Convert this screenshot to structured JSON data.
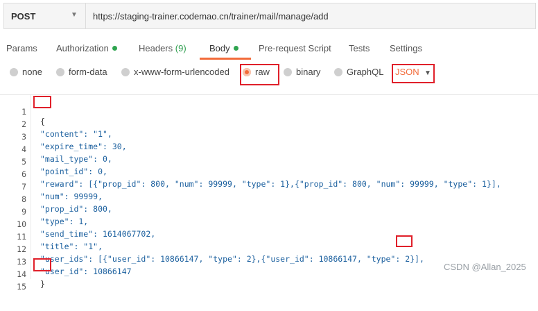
{
  "request": {
    "method": "POST",
    "url": "https://staging-trainer.codemao.cn/trainer/mail/manage/add"
  },
  "tabs": [
    {
      "label": "Params"
    },
    {
      "label": "Authorization"
    },
    {
      "label": "Headers",
      "count": "(9)"
    },
    {
      "label": "Body"
    },
    {
      "label": "Pre-request Script"
    },
    {
      "label": "Tests"
    },
    {
      "label": "Settings"
    }
  ],
  "body_types": [
    "none",
    "form-data",
    "x-www-form-urlencoded",
    "raw",
    "binary",
    "GraphQL"
  ],
  "selected_body_type": "raw",
  "format": "JSON",
  "code_lines": [
    {
      "n": "1",
      "t": "{"
    },
    {
      "n": "2",
      "t": "\"content\": \"1\","
    },
    {
      "n": "3",
      "t": "\"expire_time\": 30,"
    },
    {
      "n": "4",
      "t": "\"mail_type\": 0,"
    },
    {
      "n": "5",
      "t": "\"point_id\": 0,"
    },
    {
      "n": "6",
      "t": "\"reward\": [{\"prop_id\": 800, \"num\": 99999, \"type\": 1},{\"prop_id\": 800, \"num\": 99999, \"type\": 1}],"
    },
    {
      "n": "7",
      "t": "\"num\": 99999,"
    },
    {
      "n": "8",
      "t": "\"prop_id\": 800,"
    },
    {
      "n": "9",
      "t": "\"type\": 1,"
    },
    {
      "n": "10",
      "t": "\"send_time\": 1614067702,"
    },
    {
      "n": "11",
      "t": "\"title\": \"1\","
    },
    {
      "n": "12",
      "t": "\"user_ids\": [{\"user_id\": 10866147, \"type\": 2},{\"user_id\": 10866147, \"type\": 2}],"
    },
    {
      "n": "13",
      "t": "\"user_id\": 10866147"
    },
    {
      "n": "14",
      "t": "}"
    },
    {
      "n": "15",
      "t": ""
    }
  ],
  "watermark": "CSDN @Allan_2025",
  "colors": {
    "accent": "#f26b3a",
    "status_green": "#2ea44f",
    "highlight_box": "#e0202a"
  }
}
